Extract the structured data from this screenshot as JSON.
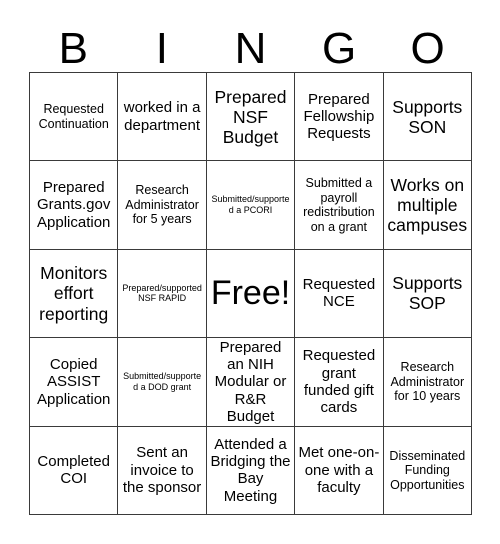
{
  "header": {
    "letters": [
      "B",
      "I",
      "N",
      "G",
      "O"
    ]
  },
  "grid": {
    "rows": 5,
    "columns": 5,
    "border_color": "#3a3a3a",
    "background_color": "#ffffff",
    "text_color": "#000000",
    "cells": [
      {
        "text": "Requested Continuation",
        "size": "sm"
      },
      {
        "text": "worked in a department",
        "size": "md"
      },
      {
        "text": "Prepared NSF Budget",
        "size": "lg"
      },
      {
        "text": "Prepared Fellowship Requests",
        "size": "md"
      },
      {
        "text": "Supports SON",
        "size": "lg"
      },
      {
        "text": "Prepared Grants.gov Application",
        "size": "md"
      },
      {
        "text": "Research Administrator for 5 years",
        "size": "sm"
      },
      {
        "text": "Submitted/supported a PCORI",
        "size": "xs"
      },
      {
        "text": "Submitted a payroll redistribution on a grant",
        "size": "sm"
      },
      {
        "text": "Works on multiple campuses",
        "size": "lg"
      },
      {
        "text": "Monitors effort reporting",
        "size": "lg"
      },
      {
        "text": "Prepared/supported NSF RAPID",
        "size": "xs"
      },
      {
        "text": "Free!",
        "size": "free"
      },
      {
        "text": "Requested NCE",
        "size": "md"
      },
      {
        "text": "Supports SOP",
        "size": "lg"
      },
      {
        "text": "Copied ASSIST Application",
        "size": "md"
      },
      {
        "text": "Submitted/supported a DOD grant",
        "size": "xs"
      },
      {
        "text": "Prepared an NIH Modular or R&R Budget",
        "size": "md"
      },
      {
        "text": "Requested grant funded gift cards",
        "size": "md"
      },
      {
        "text": "Research Administrator for 10 years",
        "size": "sm"
      },
      {
        "text": "Completed COI",
        "size": "md"
      },
      {
        "text": "Sent an invoice to the sponsor",
        "size": "md"
      },
      {
        "text": "Attended a Bridging the Bay Meeting",
        "size": "md"
      },
      {
        "text": "Met one-on-one with a faculty",
        "size": "md"
      },
      {
        "text": "Disseminated Funding Opportunities",
        "size": "sm"
      }
    ]
  }
}
